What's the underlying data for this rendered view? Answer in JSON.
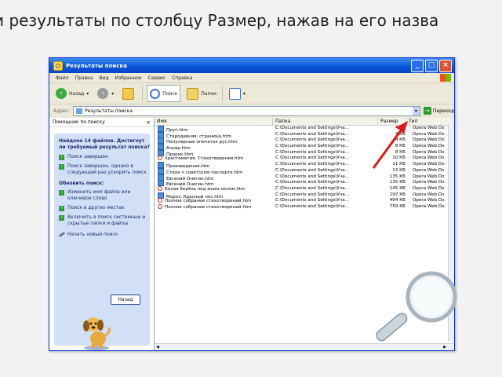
{
  "slide": {
    "heading": "м результаты по столбцу Размер, нажав на его назва"
  },
  "window": {
    "title": "Результаты поиска",
    "menu": [
      "Файл",
      "Правка",
      "Вид",
      "Избранное",
      "Сервис",
      "Справка"
    ],
    "toolbar": {
      "back": "Назад",
      "search": "Поиск",
      "folders": "Папки"
    },
    "address": {
      "label": "Адрес:",
      "value": "Результаты поиска",
      "go": "Переход"
    }
  },
  "search_pane": {
    "header": "Помощник по поиску",
    "question": "Найдено 14 файлов. Достигнут ли требуемый результат поиска?",
    "options": [
      "Поиск завершен",
      "Поиск завершен, однако в следующий раз ускорить поиск",
      "Обновить поиск:",
      "Изменить имя файла или ключевое слово",
      "Поиск в других местах",
      "Включить в поиск системные и скрытые папки и файлы"
    ],
    "new_search": "Начать новый поиск",
    "back_button": "Назад"
  },
  "results": {
    "columns": {
      "name": "Имя",
      "folder": "Папка",
      "size": "Размер",
      "type": "Тип"
    },
    "rows": [
      {
        "name": "Пруп.htm",
        "folder": "C:\\Documents and Settings\\Уча...",
        "size": "4 КБ",
        "type": "Opera Web Do",
        "icon": "html"
      },
      {
        "name": "Стародавняя, страница.htm",
        "folder": "C:\\Documents and Settings\\Уча...",
        "size": "4 КБ",
        "type": "Opera Web Do",
        "icon": "html"
      },
      {
        "name": "Популярные опечаток рус.htm",
        "folder": "C:\\Documents and Settings\\Уча...",
        "size": "4 КБ",
        "type": "Opera Web Do",
        "icon": "html"
      },
      {
        "name": "Ачнар.htm",
        "folder": "C:\\Documents and Settings\\Уча...",
        "size": "8 КБ",
        "type": "Opera Web Do",
        "icon": "html"
      },
      {
        "name": "Пророк.htm",
        "folder": "C:\\Documents and Settings\\Уча...",
        "size": "8 КБ",
        "type": "Opera Web Do",
        "icon": "html"
      },
      {
        "name": "Хрестоматия. Стихотворения.htm",
        "folder": "C:\\Documents and Settings\\Уча...",
        "size": "10 КБ",
        "type": "Opera Web Do",
        "icon": "opera"
      },
      {
        "name": "Произведения.htm",
        "folder": "C:\\Documents and Settings\\Уча...",
        "size": "11 КБ",
        "type": "Opera Web Do",
        "icon": "html"
      },
      {
        "name": "Стихи о советском паспорте.htm",
        "folder": "C:\\Documents and Settings\\Уча...",
        "size": "13 КБ",
        "type": "Opera Web Do",
        "icon": "html"
      },
      {
        "name": "Евгений Онегин.htm",
        "folder": "C:\\Documents and Settings\\Уча...",
        "size": "135 КБ",
        "type": "Opera Web Do",
        "icon": "html"
      },
      {
        "name": "Евгений Онегин.htm",
        "folder": "C:\\Documents and Settings\\Уча...",
        "size": "135 КБ",
        "type": "Opera Web Do",
        "icon": "html"
      },
      {
        "name": "Белая берёза под моим окном.htm",
        "folder": "C:\\Documents and Settings\\Уча...",
        "size": "145 КБ",
        "type": "Opera Web Do",
        "icon": "opera"
      },
      {
        "name": "Мороз, Красный нос.htm",
        "folder": "C:\\Documents and Settings\\Уча...",
        "size": "197 КБ",
        "type": "Opera Web Do",
        "icon": "html"
      },
      {
        "name": "Полное собрание стихотворений.htm",
        "folder": "C:\\Documents and Settings\\Уча...",
        "size": "494 КБ",
        "type": "Opera Web Do",
        "icon": "opera"
      },
      {
        "name": "Полное собрание стихотворений.htm",
        "folder": "C:\\Documents and Settings\\Уча...",
        "size": "759 КБ",
        "type": "Opera Web Do",
        "icon": "opera"
      }
    ]
  },
  "colors": {
    "pointer": "#e01818",
    "titlebar": "#0a54d8"
  }
}
